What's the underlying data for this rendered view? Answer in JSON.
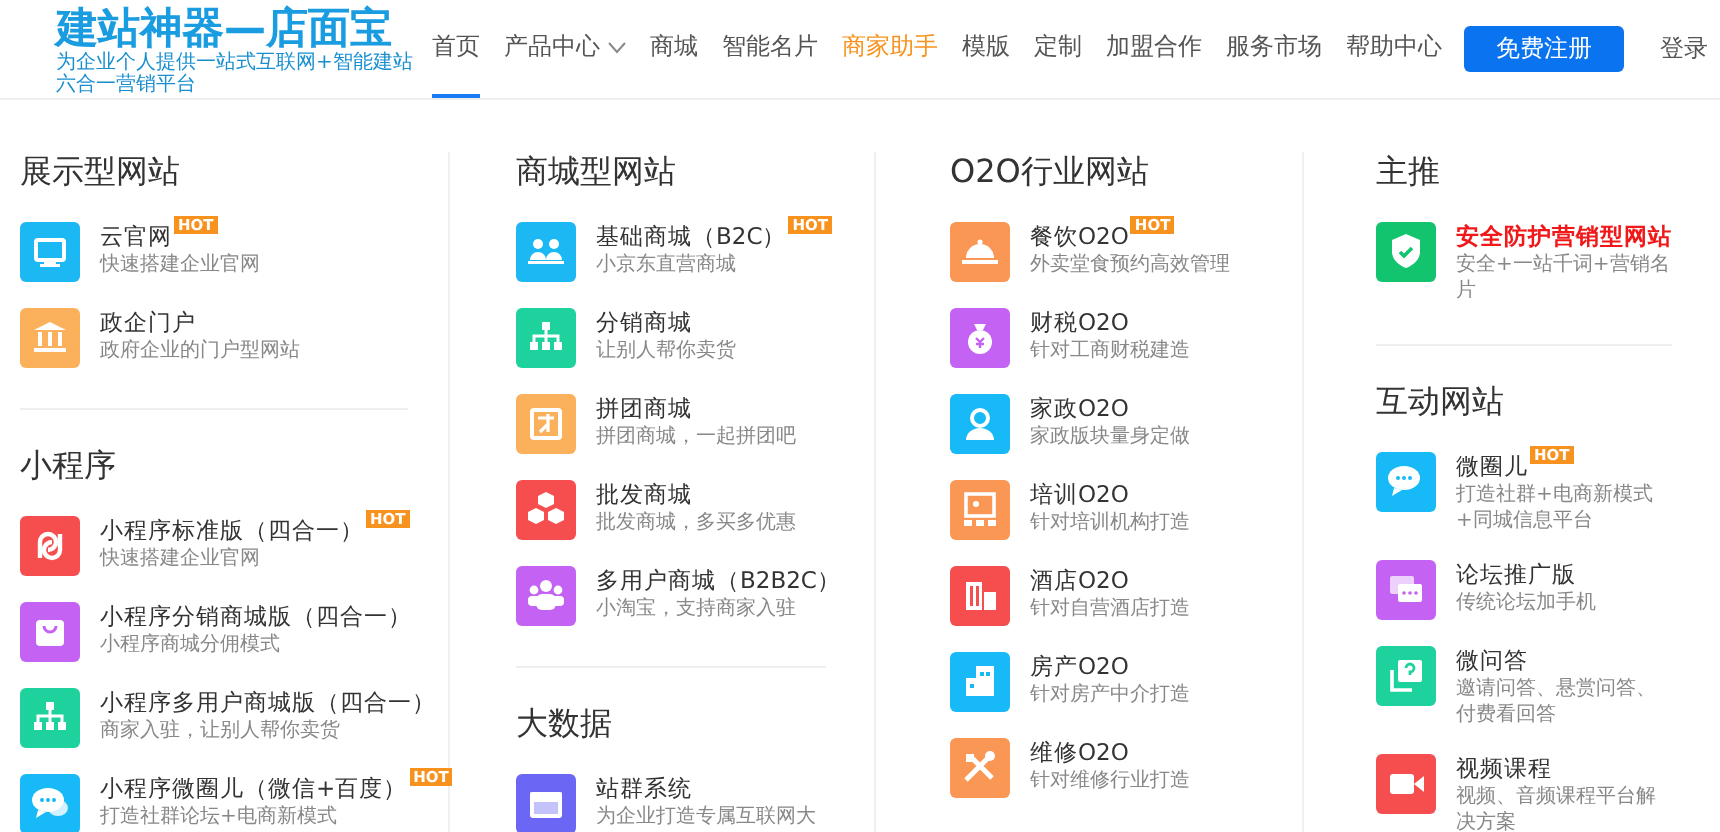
{
  "header": {
    "logo": {
      "title": "建站神器—店面宝",
      "tagline": "为企业个人提供一站式互联网+智能建站六合一营销平台"
    },
    "nav": [
      {
        "label": "首页",
        "selected": true,
        "kind": "normal",
        "dropdown": false
      },
      {
        "label": "产品中心",
        "selected": false,
        "kind": "normal",
        "dropdown": true
      },
      {
        "label": "商城",
        "selected": false,
        "kind": "normal",
        "dropdown": false
      },
      {
        "label": "智能名片",
        "selected": false,
        "kind": "normal",
        "dropdown": false
      },
      {
        "label": "商家助手",
        "selected": false,
        "kind": "promo",
        "dropdown": false
      },
      {
        "label": "模版",
        "selected": false,
        "kind": "normal",
        "dropdown": false
      },
      {
        "label": "定制",
        "selected": false,
        "kind": "normal",
        "dropdown": false
      },
      {
        "label": "加盟合作",
        "selected": false,
        "kind": "normal",
        "dropdown": false
      },
      {
        "label": "服务市场",
        "selected": false,
        "kind": "normal",
        "dropdown": false
      },
      {
        "label": "帮助中心",
        "selected": false,
        "kind": "normal",
        "dropdown": false
      }
    ],
    "register_button": "免费注册",
    "login_link": "登录"
  },
  "columns": [
    {
      "sections": [
        {
          "title": "展示型网站",
          "items": [
            {
              "title": "云官网",
              "description": "快速搭建企业官网",
              "color": "#1cb8f4",
              "hot": "HOT",
              "highlighted": false
            },
            {
              "title": "政企门户",
              "description": "政府企业的门户型网站",
              "color": "#fbb05b",
              "highlighted": false
            }
          ]
        },
        {
          "title": "小程序",
          "items": [
            {
              "title": "小程序标准版（四合一）",
              "description": "快速搭建企业官网",
              "color": "#f64e4e",
              "hot": "HOT",
              "highlighted": false
            },
            {
              "title": "小程序分销商城版（四合一）",
              "description": "小程序商城分佣模式",
              "color": "#c462f3",
              "highlighted": false
            },
            {
              "title": "小程序多用户商城版（四合一）",
              "description": "商家入驻，让别人帮你卖货",
              "color": "#1ed29d",
              "highlighted": false
            },
            {
              "title": "小程序微圈儿（微信+百度）",
              "description": "打造社群论坛+电商新模式",
              "color": "#17b9f6",
              "hot": "HOT",
              "highlighted": false
            }
          ]
        }
      ]
    },
    {
      "sections": [
        {
          "title": "商城型网站",
          "items": [
            {
              "title": "基础商城（B2C）",
              "description": "小京东直营商城",
              "color": "#1cb8f4",
              "hot": "HOT",
              "highlighted": false
            },
            {
              "title": "分销商城",
              "description": "让别人帮你卖货",
              "color": "#1ed29d",
              "highlighted": false
            },
            {
              "title": "拼团商城",
              "description": "拼团商城，一起拼团吧",
              "color": "#fbb05b",
              "highlighted": false
            },
            {
              "title": "批发商城",
              "description": "批发商城，多买多优惠",
              "color": "#f64e4e",
              "highlighted": false
            },
            {
              "title": "多用户商城（B2B2C）",
              "description": "小淘宝，支持商家入驻",
              "color": "#c462f3",
              "highlighted": false
            }
          ]
        },
        {
          "title": "大数据",
          "items": [
            {
              "title": "站群系统",
              "description": "为企业打造专属互联网大",
              "color": "#6c66f5",
              "highlighted": false
            }
          ]
        }
      ]
    },
    {
      "sections": [
        {
          "title": "O2O行业网站",
          "items": [
            {
              "title": "餐饮O2O",
              "description": "外卖堂食预约高效管理",
              "color": "#fb9755",
              "hot": "HOT",
              "highlighted": false
            },
            {
              "title": "财税O2O",
              "description": "针对工商财税建造",
              "color": "#c462f3",
              "highlighted": false
            },
            {
              "title": "家政O2O",
              "description": "家政版块量身定做",
              "color": "#17b9f6",
              "highlighted": false
            },
            {
              "title": "培训O2O",
              "description": "针对培训机构打造",
              "color": "#fb9755",
              "highlighted": false
            },
            {
              "title": "酒店O2O",
              "description": "针对自营酒店打造",
              "color": "#f64e4e",
              "highlighted": false
            },
            {
              "title": "房产O2O",
              "description": "针对房产中介打造",
              "color": "#17b9f6",
              "highlighted": false
            },
            {
              "title": "维修O2O",
              "description": "针对维修行业打造",
              "color": "#fb9755",
              "highlighted": false
            }
          ]
        }
      ]
    },
    {
      "sections": [
        {
          "title": "主推",
          "items": [
            {
              "title": "安全防护营销型网站",
              "description": "安全+一站千词+营销名片",
              "color": "#12c46e",
              "highlighted": true
            }
          ]
        },
        {
          "title": "互动网站",
          "items": [
            {
              "title": "微圈儿",
              "description": "打造社群+电商新模式+同城信息平台",
              "color": "#17b9f6",
              "hot": "HOT",
              "highlighted": false
            },
            {
              "title": "论坛推广版",
              "description": "传统论坛加手机",
              "color": "#c462f3",
              "highlighted": false
            },
            {
              "title": "微问答",
              "description": "邀请问答、悬赏问答、付费看回答",
              "color": "#1ed29d",
              "highlighted": false
            },
            {
              "title": "视频课程",
              "description": "视频、音频课程平台解决方案",
              "color": "#f64e4e",
              "highlighted": false
            }
          ]
        }
      ]
    }
  ]
}
